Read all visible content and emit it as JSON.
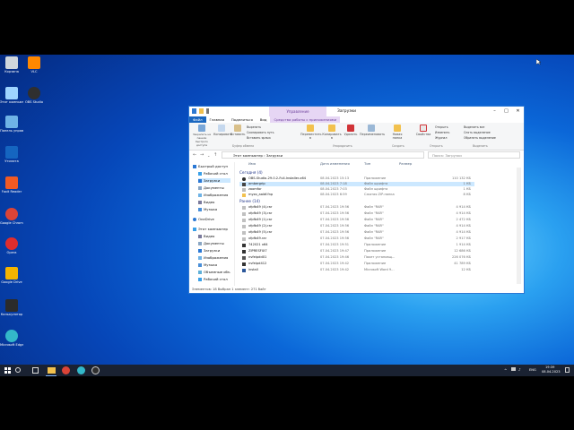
{
  "desktop": {
    "icons": [
      {
        "label": "Корзина",
        "color": "#cfd6dc"
      },
      {
        "label": "Этот компьютер",
        "color": "#9ed4ff"
      },
      {
        "label": "Панель управления",
        "color": "#6fb3e6"
      },
      {
        "label": "Foxit Reader",
        "color": "#f05a24"
      },
      {
        "label": "Google Chrome",
        "color": "#db4437"
      },
      {
        "label": "Opera",
        "color": "#e02d2d"
      },
      {
        "label": "VLC",
        "color": "#ff8800"
      },
      {
        "label": "Калькулятор",
        "color": "#2b2b2b"
      },
      {
        "label": "Microsoft Edge",
        "color": "#33b8c9"
      },
      {
        "label": "Google Drive",
        "color": "#f4b400"
      },
      {
        "label": "OBS Studio",
        "color": "#2f2f2f"
      },
      {
        "label": "Утилита",
        "color": "#1565c0"
      }
    ]
  },
  "window": {
    "title": "Загрузки",
    "context_tab": "Управление",
    "ribbon_tabs": [
      "Файл",
      "Главная",
      "Поделиться",
      "Вид",
      "Средства работы с приложениями"
    ],
    "ribbon": {
      "pin": "Закрепить на панели быстрого доступа",
      "copy": "Копировать",
      "paste": "Вставить",
      "cut": "Вырезать",
      "copy_path": "Скопировать путь",
      "paste_shortcut": "Вставить ярлык",
      "move_to": "Переместить в",
      "copy_to": "Копировать в",
      "delete": "Удалить",
      "rename": "Переименовать",
      "new_folder": "Новая папка",
      "properties": "Свойства",
      "open": "Открыть",
      "edit": "Изменить",
      "history": "Журнал",
      "select_all": "Выделить все",
      "select_none": "Снять выделение",
      "invert": "Обратить выделение",
      "group_clipboard": "Буфер обмена",
      "group_organize": "Упорядочить",
      "group_create": "Создать",
      "group_open": "Открыть",
      "group_select": "Выделить"
    },
    "address": "Этот компьютер › Загрузки",
    "search_placeholder": "Поиск: Загрузки",
    "nav": [
      "Быстрый доступ",
      "Рабочий стол",
      "Загрузки",
      "Документы",
      "Изображения",
      "Видео",
      "Музыка",
      "OneDrive",
      "Этот компьютер",
      "Видео",
      "Документы",
      "Загрузки",
      "Изображения",
      "Музыка",
      "Объемные объ",
      "Рабочий стол"
    ],
    "columns": [
      "Имя",
      "Дата изменения",
      "Тип",
      "Размер"
    ],
    "groups": [
      {
        "title": "Сегодня (4)",
        "rows": [
          {
            "name": "OBS-Studio-29.0.2-Full-Installer-x64",
            "date": "08.04.2023 15:13",
            "type": "Приложение",
            "size": "110 132 КБ"
          },
          {
            "name": "ambergrip",
            "date": "08.04.2023 7:18",
            "type": "Файл шрифта",
            "size": "1 КБ"
          },
          {
            "name": "zoomfor",
            "date": "08.04.2023 7:03",
            "type": "Файл шрифта",
            "size": "1 КБ"
          },
          {
            "name": "myzo_aaldf.fnp",
            "date": "08.04.2023 6:59",
            "type": "Сжатая ZIP-папка",
            "size": "8 КБ"
          }
        ]
      },
      {
        "title": "Ранее (14)",
        "rows": [
          {
            "name": "xfpfb49 (4).rar",
            "date": "07.04.2023 19:56",
            "type": "Файл \"RAR\"",
            "size": "4 914 КБ"
          },
          {
            "name": "xfpfb49 (3).rar",
            "date": "07.04.2023 19:56",
            "type": "Файл \"RAR\"",
            "size": "4 914 КБ"
          },
          {
            "name": "xfpfb49 (1).rar",
            "date": "07.04.2023 19:56",
            "type": "Файл \"RAR\"",
            "size": "2 472 КБ"
          },
          {
            "name": "xfpfb49 (2).rar",
            "date": "07.04.2023 19:56",
            "type": "Файл \"RAR\"",
            "size": "4 914 КБ"
          },
          {
            "name": "xfpfb49 (5).rar",
            "date": "07.04.2023 19:56",
            "type": "Файл \"RAR\"",
            "size": "4 914 КБ"
          },
          {
            "name": "xfpfb49.rar",
            "date": "07.04.2023 19:56",
            "type": "Файл \"RAR\"",
            "size": "2 917 КБ"
          },
          {
            "name": "742021 x64",
            "date": "07.04.2023 19:51",
            "type": "Приложение",
            "size": "1 914 КБ"
          },
          {
            "name": "ZIPRESFIX7",
            "date": "07.04.2023 19:47",
            "type": "Приложение",
            "size": "12 686 КБ"
          },
          {
            "name": "nvfeipdd01",
            "date": "07.04.2023 19:46",
            "type": "Пакет установщ...",
            "size": "226 076 КБ"
          },
          {
            "name": "nvfeipd412",
            "date": "07.04.2023 19:42",
            "type": "Приложение",
            "size": "41 789 КБ"
          },
          {
            "name": "install",
            "date": "07.04.2023 19:42",
            "type": "Microsoft Word 9...",
            "size": "12 КБ"
          }
        ]
      }
    ],
    "status": "Элементов: 18    Выбран 1 элемент: 271 байт"
  },
  "taskbar": {
    "time": "19:39",
    "date": "08.04.2023",
    "lang": "ENG"
  },
  "colors": {
    "accent": "#1a67c0",
    "selection": "#cce8ff",
    "taskbar": "#1a2232"
  }
}
